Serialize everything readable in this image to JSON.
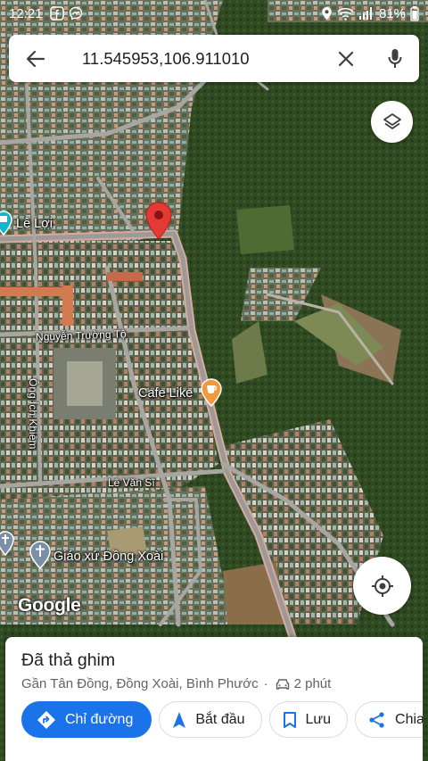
{
  "status_bar": {
    "time": "12:21",
    "battery": "81%",
    "icons": [
      "facebook-icon",
      "messenger-icon",
      "location-icon",
      "wifi-icon",
      "signal-icon",
      "battery-icon"
    ]
  },
  "search": {
    "query": "11.545953,106.911010"
  },
  "map": {
    "labels": {
      "le_loi": "Lê Lợi",
      "nguyen_truong_to": "Nguyễn Trường Tộ",
      "ong_ich_khiem": "Ông Ích Khiêm",
      "cafe_like": "Cafe Like",
      "le_van_si": "Lê Văn Sĩ",
      "giao_xu": "Giáo xứ Đồng Xoài"
    },
    "attribution": "Google",
    "pin_color": "#e53935"
  },
  "place": {
    "title": "Đã thả ghim",
    "address": "Gần Tân Đồng, Đồng Xoài, Bình Phước",
    "separator": "·",
    "drive_time": "2 phút"
  },
  "actions": {
    "directions": "Chỉ đường",
    "start": "Bắt đầu",
    "save": "Lưu",
    "share": "Chia sẻ"
  },
  "colors": {
    "accent": "#1a73e8",
    "title": "#202124",
    "secondary": "#5f6368"
  }
}
